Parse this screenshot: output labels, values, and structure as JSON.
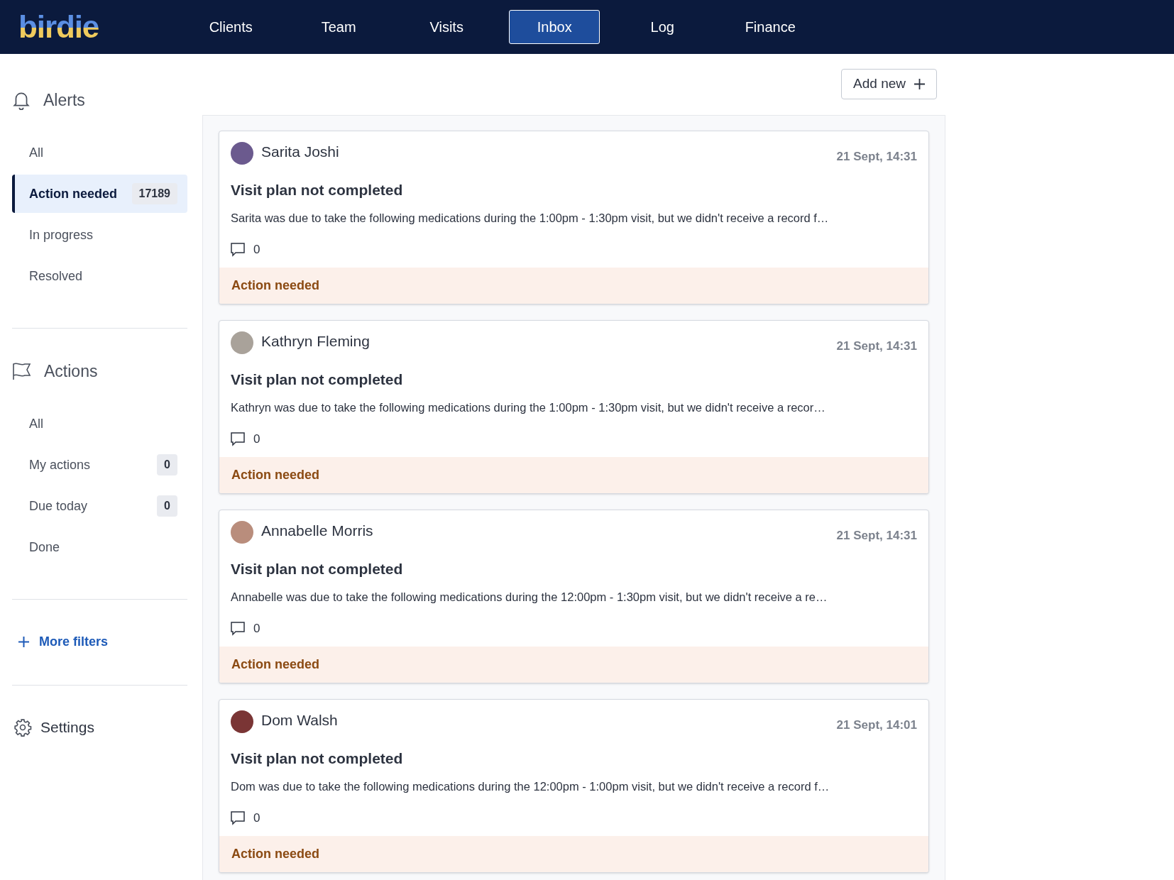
{
  "logo": "birdie",
  "nav": [
    {
      "label": "Clients",
      "selected": false
    },
    {
      "label": "Team",
      "selected": false
    },
    {
      "label": "Visits",
      "selected": false
    },
    {
      "label": "Inbox",
      "selected": true
    },
    {
      "label": "Log",
      "selected": false
    },
    {
      "label": "Finance",
      "selected": false
    }
  ],
  "sidebar": {
    "sections": [
      {
        "kind": "alerts",
        "title": "Alerts",
        "items": [
          {
            "label": "All",
            "selected": false
          },
          {
            "label": "Action needed",
            "count": "17189",
            "selected": true
          },
          {
            "label": "In progress",
            "selected": false
          },
          {
            "label": "Resolved",
            "selected": false
          }
        ]
      },
      {
        "kind": "actions",
        "title": "Actions",
        "items": [
          {
            "label": "All",
            "selected": false
          },
          {
            "label": "My actions",
            "count": "0",
            "selected": false
          },
          {
            "label": "Due today",
            "count": "0",
            "selected": false
          },
          {
            "label": "Done",
            "selected": false
          }
        ]
      }
    ],
    "more_filters": "More filters",
    "settings": "Settings"
  },
  "add_button": "Add new",
  "alerts": [
    {
      "name": "Sarita Joshi",
      "time": "21 Sept, 14:31",
      "title": "Visit plan not completed",
      "description": "Sarita was due to take the following medications during the 1:00pm - 1:30pm visit, but we didn't receive a record f…",
      "comments": "0",
      "status": "Action needed"
    },
    {
      "name": "Kathryn Fleming",
      "time": "21 Sept, 14:31",
      "title": "Visit plan not completed",
      "description": "Kathryn was due to take the following medications during the 1:00pm - 1:30pm visit, but we didn't receive a recor…",
      "comments": "0",
      "status": "Action needed"
    },
    {
      "name": "Annabelle Morris",
      "time": "21 Sept, 14:31",
      "title": "Visit plan not completed",
      "description": "Annabelle was due to take the following medications during the 12:00pm - 1:30pm visit, but we didn't receive a re…",
      "comments": "0",
      "status": "Action needed"
    },
    {
      "name": "Dom Walsh",
      "time": "21 Sept, 14:01",
      "title": "Visit plan not completed",
      "description": "Dom was due to take the following medications during the 12:00pm - 1:00pm visit, but we didn't receive a record f…",
      "comments": "0",
      "status": "Action needed"
    }
  ]
}
